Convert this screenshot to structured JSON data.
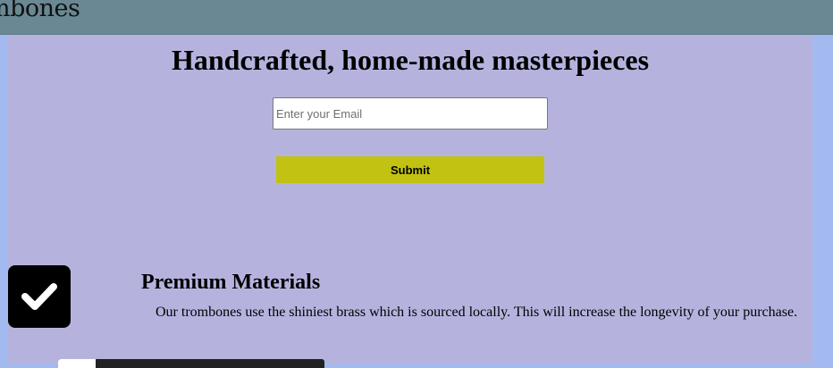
{
  "header": {
    "logo_text": "mbones"
  },
  "hero": {
    "headline": "Handcrafted, home-made masterpieces",
    "email_placeholder": "Enter your Email",
    "email_value": "",
    "submit_label": "Submit"
  },
  "features": [
    {
      "icon": "check-icon",
      "title": "Premium Materials",
      "text": "Our trombones use the shiniest brass which is sourced locally. This will increase the longevity of your purchase."
    }
  ],
  "colors": {
    "header_bg": "#6a8894",
    "page_bg": "#a3baf0",
    "content_bg": "#b5b3de",
    "submit_bg": "#c2c212",
    "icon_bg": "#000000"
  }
}
